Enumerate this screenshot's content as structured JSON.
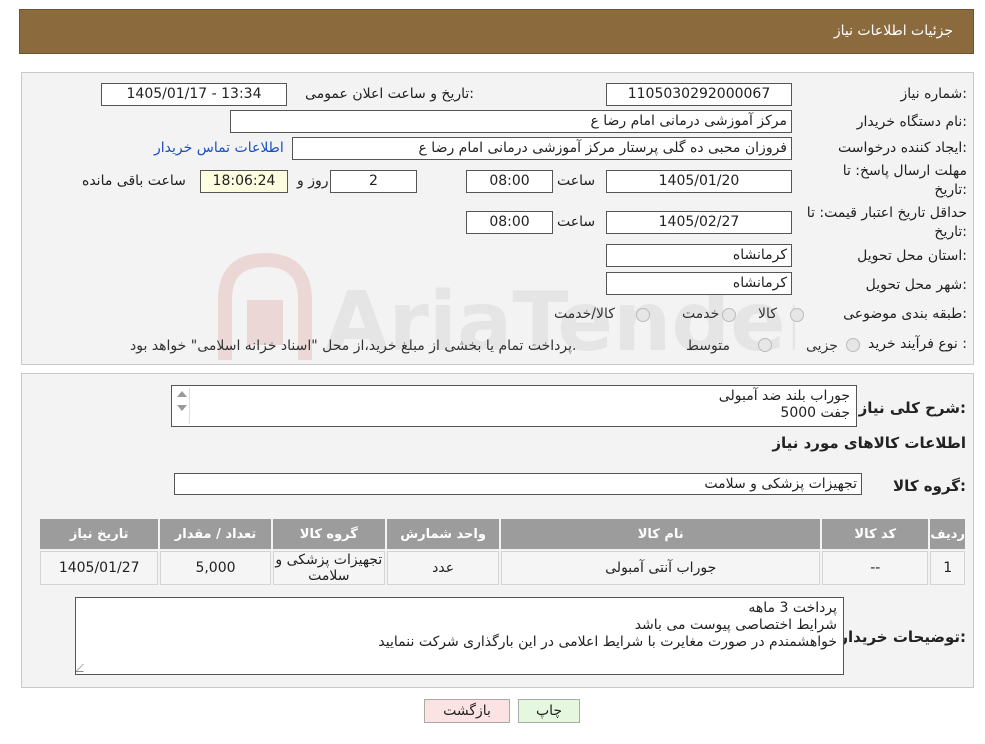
{
  "header": {
    "title": "جزئیات اطلاعات نیاز"
  },
  "form": {
    "need_number_label": "شماره نیاز:",
    "need_number": "1105030292000067",
    "announce_label": "تاریخ و ساعت اعلان عمومی:",
    "announce_value": "1405/01/17 - 13:34",
    "buyer_org_label": "نام دستگاه خریدار:",
    "buyer_org": "مرکز آموزشی  درمانی امام رضا  ع",
    "creator_label": "ایجاد کننده درخواست:",
    "creator": "فروزان محبی ده گلی پرستار مرکز آموزشی  درمانی امام رضا  ع",
    "contact_link": "اطلاعات تماس خریدار",
    "deadline_label_1": "مهلت ارسال پاسخ: تا",
    "deadline_label_2": "تاریخ:",
    "deadline_date": "1405/01/20",
    "time_label": "ساعت",
    "deadline_time": "08:00",
    "days_value": "2",
    "days_label": "روز و",
    "remaining_time": "18:06:24",
    "remaining_label": "ساعت باقی مانده",
    "validity_label_1": "حداقل تاریخ اعتبار قیمت: تا",
    "validity_label_2": "تاریخ:",
    "validity_date": "1405/02/27",
    "validity_time": "08:00",
    "province_label": "استان محل تحویل:",
    "province": "کرمانشاه",
    "city_label": "شهر محل تحویل:",
    "city": "کرمانشاه",
    "category_label": "طبقه بندی موضوعی:",
    "category_options": [
      "کالا",
      "خدمت",
      "کالا/خدمت"
    ],
    "process_label": "نوع فرآیند خرید :",
    "process_options": [
      "جزیی",
      "متوسط"
    ],
    "process_note": "پرداخت تمام یا بخشی از مبلغ خرید،از محل \"اسناد خزانه اسلامی\" خواهد بود."
  },
  "details": {
    "summary_label": "شرح کلی نیاز:",
    "summary_line1": "جوراب بلند ضد آمبولی",
    "summary_line2": "5000 جفت",
    "goods_info_title": "اطلاعات کالاهای مورد نیاز",
    "goods_group_label": "گروه کالا:",
    "goods_group": "تجهیزات پزشکی و سلامت",
    "table": {
      "headers": [
        "ردیف",
        "کد کالا",
        "نام کالا",
        "واحد شمارش",
        "گروه کالا",
        "تعداد / مقدار",
        "تاریخ نیاز"
      ],
      "rows": [
        [
          "1",
          "--",
          "جوراب آنتی آمبولی",
          "عدد",
          "تجهیزات پزشکی و سلامت",
          "5,000",
          "1405/01/27"
        ]
      ]
    },
    "buyer_notes_label": "توضیحات خریدار:",
    "buyer_notes": [
      "پرداخت 3 ماهه",
      "شرایط اختصاصی پیوست می باشد",
      "خواهشمندم  در صورت مغایرت با شرایط اعلامی در این بارگذاری شرکت ننمایید"
    ]
  },
  "buttons": {
    "print": "چاپ",
    "back": "بازگشت"
  },
  "watermark": "AriaTender.neT",
  "colors": {
    "header_bg": "#8b6a3e",
    "link": "#1a4fc0",
    "print_btn": "#e6f7e0",
    "back_btn": "#fbe3e3",
    "table_header": "#9c9c9c"
  }
}
